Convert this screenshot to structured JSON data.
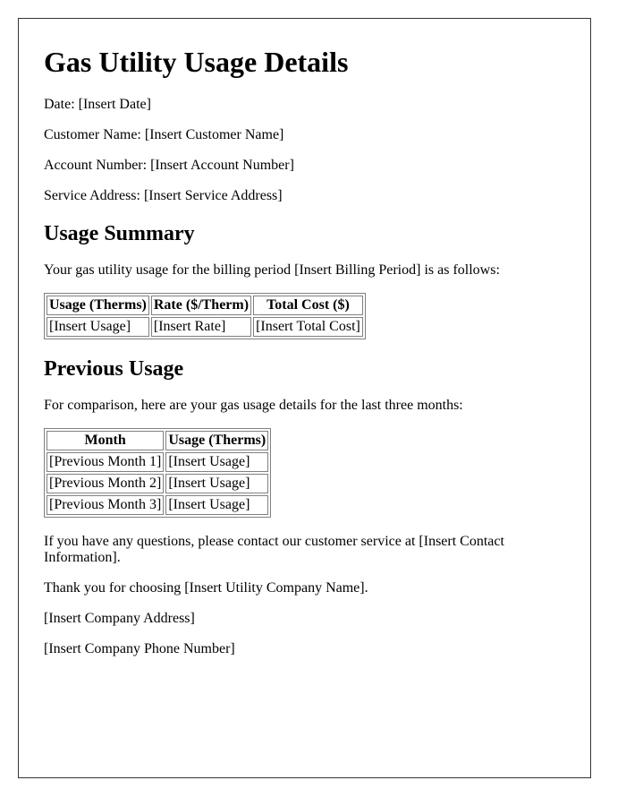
{
  "document": {
    "title": "Gas Utility Usage Details",
    "fields": [
      "Date: [Insert Date]",
      "Customer Name: [Insert Customer Name]",
      "Account Number: [Insert Account Number]",
      "Service Address: [Insert Service Address]"
    ],
    "usage_summary": {
      "heading": "Usage Summary",
      "intro": "Your gas utility usage for the billing period [Insert Billing Period] is as follows:",
      "table": {
        "headers": [
          "Usage (Therms)",
          "Rate ($/Therm)",
          "Total Cost ($)"
        ],
        "rows": [
          [
            "[Insert Usage]",
            "[Insert Rate]",
            "[Insert Total Cost]"
          ]
        ]
      }
    },
    "previous_usage": {
      "heading": "Previous Usage",
      "intro": "For comparison, here are your gas usage details for the last three months:",
      "table": {
        "headers": [
          "Month",
          "Usage (Therms)"
        ],
        "rows": [
          [
            "[Previous Month 1]",
            "[Insert Usage]"
          ],
          [
            "[Previous Month 2]",
            "[Insert Usage]"
          ],
          [
            "[Previous Month 3]",
            "[Insert Usage]"
          ]
        ]
      }
    },
    "closing": [
      "If you have any questions, please contact our customer service at [Insert Contact Information].",
      "Thank you for choosing [Insert Utility Company Name].",
      "[Insert Company Address]",
      "[Insert Company Phone Number]"
    ]
  }
}
